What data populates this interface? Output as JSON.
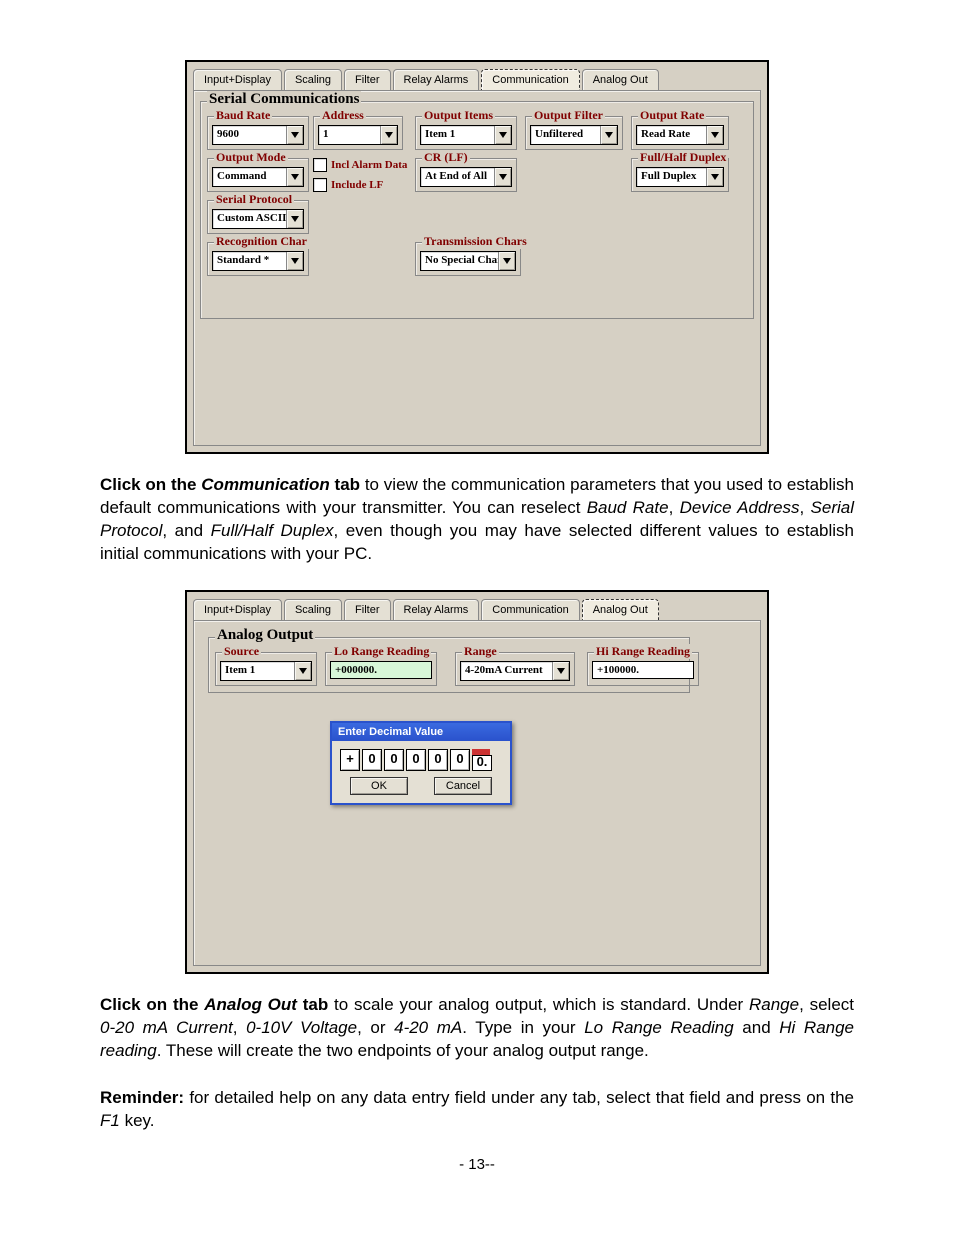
{
  "tabs": {
    "input_display": "Input+Display",
    "scaling": "Scaling",
    "filter": "Filter",
    "relay_alarms": "Relay Alarms",
    "communication": "Communication",
    "analog_out": "Analog Out"
  },
  "serial_comm": {
    "title": "Serial Communications",
    "baud_rate": {
      "label": "Baud Rate",
      "value": "9600"
    },
    "address": {
      "label": "Address",
      "value": "1"
    },
    "output_items": {
      "label": "Output Items",
      "value": "Item 1"
    },
    "output_filter": {
      "label": "Output Filter",
      "value": "Unfiltered"
    },
    "output_rate": {
      "label": "Output Rate",
      "value": "Read Rate"
    },
    "output_mode": {
      "label": "Output Mode",
      "value": "Command"
    },
    "incl_alarm_data": "Incl Alarm Data",
    "include_lf": "Include LF",
    "cr_lf": {
      "label": "CR (LF)",
      "value": "At End of All"
    },
    "full_half_duplex": {
      "label": "Full/Half Duplex",
      "value": "Full Duplex"
    },
    "serial_protocol": {
      "label": "Serial Protocol",
      "value": "Custom ASCII"
    },
    "recognition_char": {
      "label": "Recognition Char",
      "value": "Standard *"
    },
    "transmission_chars": {
      "label": "Transmission Chars",
      "value": "No Special Char"
    }
  },
  "para1": {
    "lead_bold": "Click on the ",
    "lead_italic_bold": "Communication",
    "lead_bold2": " tab",
    "rest1": " to view the communication parameters that you used to establish default communications with your transmitter. You can reselect ",
    "i1": "Baud Rate",
    "c1": ", ",
    "i2": "Device Address",
    "c2": ", ",
    "i3": "Serial Protocol",
    "c3": ", and ",
    "i4": "Full/Half Duplex",
    "rest2": ", even though you may have selected different values to establish initial communications with your PC."
  },
  "analog_out": {
    "title": "Analog Output",
    "source": {
      "label": "Source",
      "value": "Item 1"
    },
    "lo_range": {
      "label": "Lo Range Reading",
      "value": "+000000."
    },
    "range": {
      "label": "Range",
      "value": "4-20mA Current"
    },
    "hi_range": {
      "label": "Hi Range Reading",
      "value": "+100000."
    }
  },
  "popup": {
    "title": "Enter Decimal Value",
    "d0": "+",
    "d1": "0",
    "d2": "0",
    "d3": "0",
    "d4": "0",
    "d5": "0",
    "d6": "0.",
    "ok": "OK",
    "cancel": "Cancel"
  },
  "para2": {
    "lead_space": " ",
    "lead_bold": "Click on the ",
    "lead_italic_bold": "Analog Out",
    "lead_bold2": " tab",
    "rest1": " to scale your analog output, which is standard. Under ",
    "i1": "Range",
    "rest2": ", select ",
    "i2": "0-20 mA Current",
    "c1": ", ",
    "i3": "0-10V Voltage",
    "c2": ", or ",
    "i4": "4-20 mA",
    "rest3": ". Type in your ",
    "i5": "Lo Range Reading",
    "c3": " and ",
    "i6": "Hi Range reading",
    "rest4": ". These will create the two endpoints of your analog output range."
  },
  "para3": {
    "bold": "Reminder:",
    "rest1": " for detailed help on any data entry field under any tab, select that field and press on the ",
    "i1": "F1",
    "rest2": " key."
  },
  "page_number": "- 13--"
}
